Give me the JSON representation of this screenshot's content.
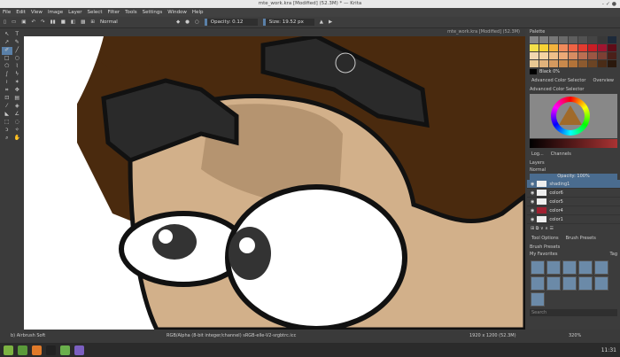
{
  "window": {
    "title": "mte_work.kra [Modified] (52.3M) * — Krita",
    "controls": "- ✓ ●"
  },
  "menu": [
    "File",
    "Edit",
    "View",
    "Image",
    "Layer",
    "Select",
    "Filter",
    "Tools",
    "Settings",
    "Window",
    "Help"
  ],
  "toolbar": {
    "blend_mode": "Normal",
    "opacity_label": "Opacity: 0.12",
    "size_label": "Size: 19.52 px"
  },
  "document_tab": "mte_work.kra [Modified] (52.3M)",
  "palette": {
    "title": "Palette",
    "selected_color": "Black 0%",
    "colors": [
      "#888",
      "#808080",
      "#777",
      "#6a6a6a",
      "#5e5e5e",
      "#525252",
      "#444",
      "#383838",
      "#1d2a3a",
      "#f4e04a",
      "#f7d234",
      "#f3b33d",
      "#f08a5b",
      "#ee6344",
      "#e23b30",
      "#c81d25",
      "#a01530",
      "#5e0c18",
      "#f2d7b0",
      "#f4d3a3",
      "#efc08a",
      "#ecaa77",
      "#d78c62",
      "#bb6f52",
      "#9b5643",
      "#7c4034",
      "#4a2019",
      "#e9c893",
      "#e1b27b",
      "#d59a5f",
      "#c8894c",
      "#b27339",
      "#8c5a2f",
      "#6b4424",
      "#4a2c17",
      "#2a180c"
    ]
  },
  "color_selector": {
    "tabs": [
      "Advanced Color Selector",
      "Overview"
    ],
    "title": "Advanced Color Selector"
  },
  "lower_tabs": [
    "Log...",
    "Channels"
  ],
  "layers": {
    "title": "Layers",
    "blend": "Normal",
    "opacity": "Opacity: 100%",
    "items": [
      {
        "name": "shading1",
        "selected": true
      },
      {
        "name": "color6"
      },
      {
        "name": "color5"
      },
      {
        "name": "color4"
      },
      {
        "name": "color1"
      }
    ]
  },
  "presets": {
    "tabs": [
      "Tool Options",
      "Brush Presets"
    ],
    "title": "Brush Presets",
    "filter": "My Favorites",
    "tag": "Tag",
    "search": "Search"
  },
  "status": {
    "brush": "b) Airbrush Soft",
    "colorspace": "RGB/Alpha (8-bit integer/channel)  sRGB-elle-V2-srgbtrc.icc",
    "dimensions": "1920 x 1200 (52.3M)",
    "zoom": "320%"
  },
  "taskbar": {
    "clock": "11:31"
  }
}
